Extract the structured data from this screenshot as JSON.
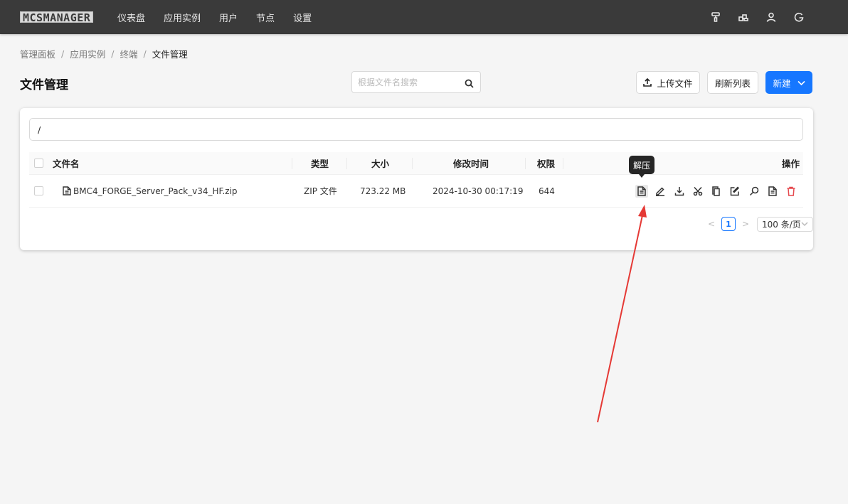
{
  "navbar": {
    "logo": "MCSMANAGER",
    "items": [
      "仪表盘",
      "应用实例",
      "用户",
      "节点",
      "设置"
    ],
    "right_icons": [
      "paint-roller-icon",
      "api-icon",
      "user-icon",
      "logout-icon"
    ]
  },
  "breadcrumb": [
    "管理面板",
    "应用实例",
    "终端",
    "文件管理"
  ],
  "page": {
    "title": "文件管理",
    "search_placeholder": "根据文件名搜索",
    "buttons": {
      "upload": "上传文件",
      "refresh": "刷新列表",
      "new": "新建"
    }
  },
  "path": "/",
  "table": {
    "columns": {
      "name": "文件名",
      "type": "类型",
      "size": "大小",
      "modified": "修改时间",
      "permission": "权限",
      "actions": "操作"
    },
    "rows": [
      {
        "name": "BMC4_FORGE_Server_Pack_v34_HF.zip",
        "type": "ZIP 文件",
        "size": "723.22 MB",
        "modified": "2024-10-30 00:17:19",
        "permission": "644"
      }
    ],
    "row_actions": [
      "unzip-icon",
      "rename-icon",
      "download-icon",
      "cut-icon",
      "copy-icon",
      "edit-icon",
      "search-icon",
      "file-icon",
      "delete-icon"
    ]
  },
  "tooltip": "解压",
  "pagination": {
    "current_page": "1",
    "page_size": "100 条/页",
    "prev": "<",
    "next": ">"
  },
  "colors": {
    "navbar": "#3a3a3a",
    "primary": "#1677ff",
    "danger": "#e5484d",
    "annotation_arrow": "#e53935"
  }
}
